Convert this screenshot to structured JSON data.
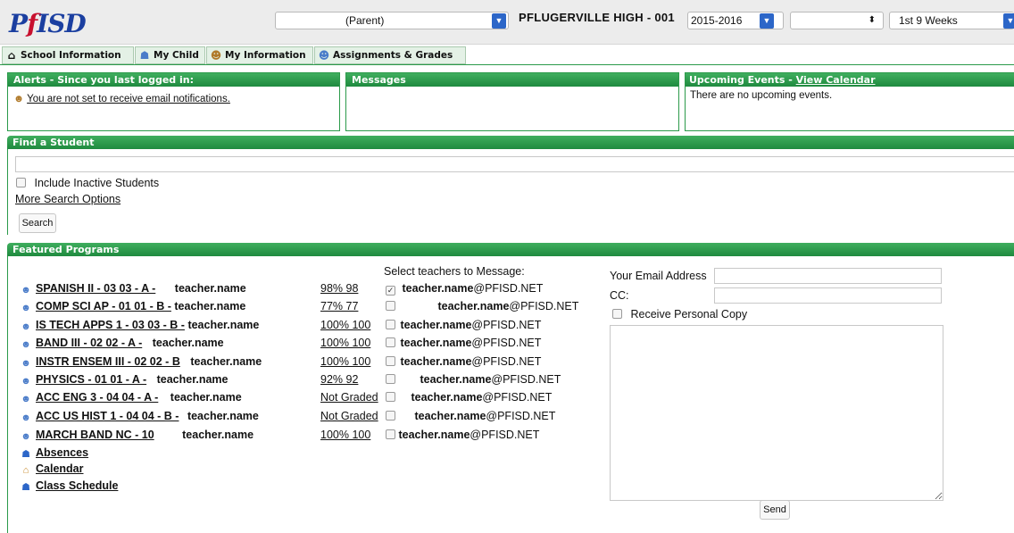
{
  "logo": {
    "part1": "P",
    "part2": "f",
    "part3": "ISD"
  },
  "header": {
    "parent_select": "(Parent)",
    "school_name": "PFLUGERVILLE HIGH - 001",
    "year_select": "2015-2016",
    "blank_select": "",
    "period_select": "1st 9 Weeks",
    "select_arrow": "▼",
    "stepper_icon": "⬍"
  },
  "tabs": [
    {
      "label": "School Information",
      "icon": "home-icon"
    },
    {
      "label": "My Child",
      "icon": "child-icon"
    },
    {
      "label": "My Information",
      "icon": "people-icon"
    },
    {
      "label": "Assignments & Grades",
      "icon": "people-icon"
    }
  ],
  "alerts": {
    "title": "Alerts - Since you last logged in:",
    "link": "You are not set to receive email notifications."
  },
  "messages": {
    "title": "Messages"
  },
  "events": {
    "title_prefix": "Upcoming Events - ",
    "title_link": "View Calendar",
    "text": "There are no upcoming events."
  },
  "find_student": {
    "title": "Find a Student",
    "search_value": "",
    "inactive_label": "Include Inactive Students",
    "more_options": "More Search Options",
    "search_button": "Search"
  },
  "featured": {
    "title": "Featured Programs",
    "select_label": "Select teachers to Message:",
    "courses": [
      {
        "name": "SPANISH II - 03 03 - A -",
        "teacher": "teacher.name",
        "grade": "98% 98",
        "checked": true,
        "email_user": "teacher.name",
        "email_domain": "@PFISD.NET"
      },
      {
        "name": "COMP SCI AP - 01 01 - B -",
        "teacher": "teacher.name",
        "grade": "77% 77",
        "checked": false,
        "email_user": "teacher.name",
        "email_domain": "@PFISD.NET"
      },
      {
        "name": "IS TECH APPS 1 - 03 03 - B -",
        "teacher": "teacher.name",
        "grade": "100% 100",
        "checked": false,
        "email_user": "teacher.name",
        "email_domain": "@PFISD.NET"
      },
      {
        "name": "BAND III - 02 02 - A -",
        "teacher": "teacher.name",
        "grade": "100% 100",
        "checked": false,
        "email_user": "teacher.name",
        "email_domain": "@PFISD.NET"
      },
      {
        "name": "INSTR ENSEM III - 02 02 - B",
        "teacher": "teacher.name",
        "grade": "100% 100",
        "checked": false,
        "email_user": "teacher.name",
        "email_domain": "@PFISD.NET"
      },
      {
        "name": "PHYSICS - 01 01 - A -",
        "teacher": "teacher.name",
        "grade": "92% 92",
        "checked": false,
        "email_user": "teacher.name",
        "email_domain": "@PFISD.NET"
      },
      {
        "name": "ACC ENG 3 - 04 04 - A -",
        "teacher": "teacher.name",
        "grade": "Not Graded",
        "checked": false,
        "email_user": "teacher.name",
        "email_domain": "@PFISD.NET"
      },
      {
        "name": "ACC US HIST 1 - 04 04 - B -",
        "teacher": "teacher.name",
        "grade": "Not Graded",
        "checked": false,
        "email_user": "teacher.name",
        "email_domain": "@PFISD.NET"
      },
      {
        "name": "MARCH BAND NC - 10",
        "teacher": "teacher.name",
        "grade": "100% 100",
        "checked": false,
        "email_user": "teacher.name",
        "email_domain": "@PFISD.NET"
      }
    ],
    "links": [
      {
        "label": "Absences",
        "icon": "child-icon"
      },
      {
        "label": "Calendar",
        "icon": "home-icon"
      },
      {
        "label": "Class Schedule",
        "icon": "child-icon"
      }
    ],
    "email_label": "Your Email Address",
    "email_value": "",
    "cc_label": "CC:",
    "cc_value": "",
    "personal_copy_label": "Receive Personal Copy",
    "message_value": "",
    "send_button": "Send"
  }
}
